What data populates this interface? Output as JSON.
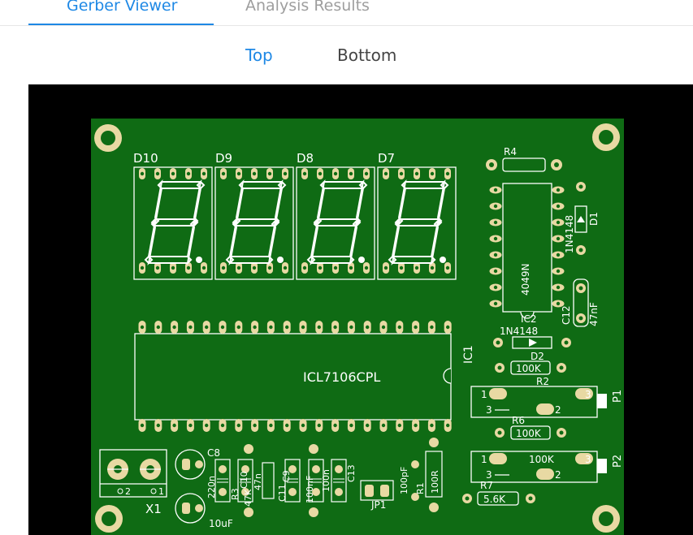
{
  "tabs": [
    {
      "label": "Gerber Viewer",
      "active": true
    },
    {
      "label": "Analysis Results",
      "active": false
    }
  ],
  "layers": [
    {
      "label": "Top",
      "active": true
    },
    {
      "label": "Bottom",
      "active": false
    }
  ],
  "colors": {
    "accent": "#1e88e5",
    "board": "#0f6b14",
    "background": "#000000",
    "pad": "#e8d9a3",
    "silkscreen": "#ffffff"
  },
  "board": {
    "displays": [
      "D10",
      "D9",
      "D8",
      "D7"
    ],
    "chip_label": "ICL7106CPL",
    "ic1": "IC1",
    "ic2": "IC2",
    "ic2_part": "4049N",
    "r4": "R4",
    "d1": "D1",
    "d1_part": "1N4148",
    "d2": "D2",
    "d2_part": "1N4148",
    "c12": "C12",
    "c12_value": "47nF",
    "r2": "R2",
    "r2_value": "100K",
    "r6": "R6",
    "r6_value": "100K",
    "p1": "P1",
    "p1_pin1": "1",
    "p1_pin2": "2",
    "p1_pin3": "3",
    "p2": "P2",
    "p2_pin1": "1",
    "p2_pin2": "2",
    "p2_pin3": "3",
    "p2_value": "100K",
    "r7": "R7",
    "r7_value": "5.6K",
    "x1": "X1",
    "x1_pin1": "1",
    "x1_pin2": "2",
    "c8": "C8",
    "c8_value": "220n",
    "c10": "C10",
    "r3": "R3",
    "r3_value": "47K",
    "c_value_47n": "47n",
    "c9": "C9",
    "c11": "C11",
    "c13": "C13",
    "c_value_100n": "100n",
    "c_value_100nf": "100nF",
    "cap_10uf": "10uF",
    "jp1": "JP1",
    "c_100pf": "100pF",
    "r1_value": "100R",
    "r1": "R1"
  }
}
